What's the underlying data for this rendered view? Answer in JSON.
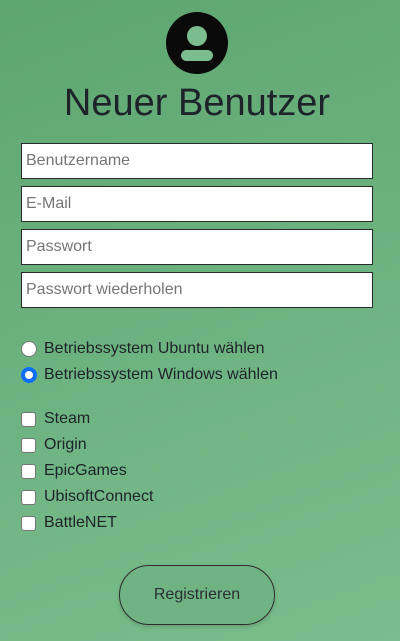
{
  "header": {
    "icon": "user-avatar-icon",
    "title": "Neuer Benutzer"
  },
  "form": {
    "username": {
      "placeholder": "Benutzername",
      "value": ""
    },
    "email": {
      "placeholder": "E-Mail",
      "value": ""
    },
    "password": {
      "placeholder": "Passwort",
      "value": ""
    },
    "password_repeat": {
      "placeholder": "Passwort wiederholen",
      "value": ""
    },
    "os_options": [
      {
        "label": "Betriebssystem Ubuntu wählen",
        "checked": false
      },
      {
        "label": "Betriebssystem Windows wählen",
        "checked": true
      }
    ],
    "platforms": [
      {
        "label": "Steam",
        "checked": false
      },
      {
        "label": "Origin",
        "checked": false
      },
      {
        "label": "EpicGames",
        "checked": false
      },
      {
        "label": "UbisoftConnect",
        "checked": false
      },
      {
        "label": "BattleNET",
        "checked": false
      }
    ],
    "submit_label": "Registrieren"
  },
  "colors": {
    "background": "#6eb482",
    "accent": "#0d6efd",
    "text": "#1e2229"
  }
}
